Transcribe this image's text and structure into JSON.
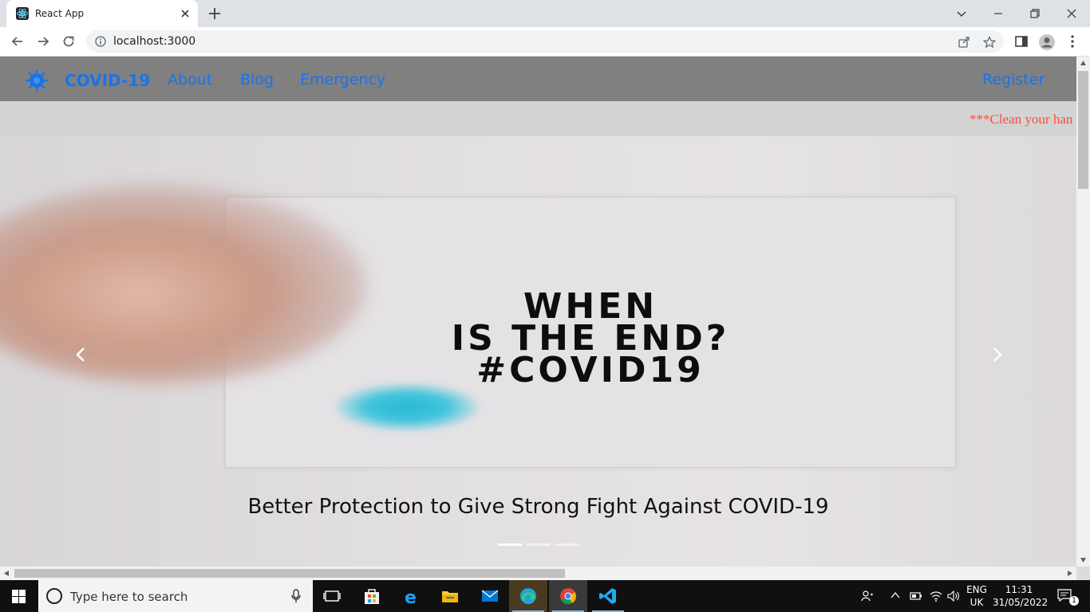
{
  "browser": {
    "tab_title": "React App",
    "url": "localhost:3000"
  },
  "site": {
    "brand": "COVID-19",
    "nav": [
      "About",
      "Blog",
      "Emergency"
    ],
    "register": "Register",
    "notice": "***Clean your han",
    "colors": {
      "nav_bg": "#808080",
      "link": "#1a73e8",
      "notice_text": "#ff4c3b"
    }
  },
  "carousel": {
    "poster_lines": [
      "WHEN",
      "IS THE END?",
      "#COVID19"
    ],
    "caption": "Better Protection to Give Strong Fight Against COVID-19",
    "slide_count": 3,
    "active_slide": 1
  },
  "taskbar": {
    "search_placeholder": "Type here to search",
    "lang": "ENG",
    "region": "UK",
    "time": "11:31",
    "date": "31/05/2022",
    "notifications": "1"
  }
}
